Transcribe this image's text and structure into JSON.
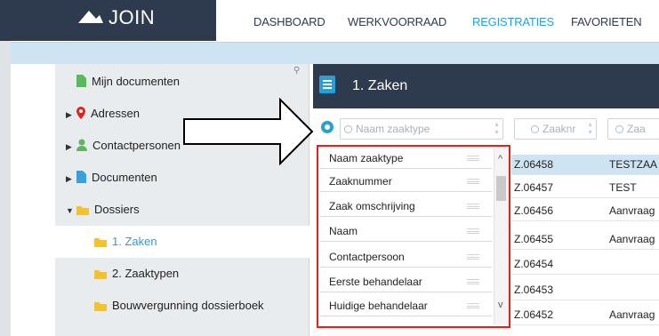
{
  "brand": {
    "name": "JOIN",
    "logo_icon": "join-logo-icon"
  },
  "nav": {
    "items": [
      "DASHBOARD",
      "WERKVOORRAAD",
      "REGISTRATIES",
      "FAVORIETEN"
    ],
    "active": "REGISTRATIES"
  },
  "colors": {
    "navy": "#2e3b4e",
    "accent": "#2a9fd6",
    "band": "#cfe4f2",
    "highlight": "#e0231d",
    "folder": "#f2c230",
    "green_doc": "#5cb85c",
    "blue_doc": "#3aa0d8",
    "red_pin": "#e0231d"
  },
  "sidebar": {
    "items": [
      {
        "label": "Mijn documenten",
        "icon": "document-icon"
      },
      {
        "label": "Adressen",
        "icon": "location-pin-icon"
      },
      {
        "label": "Contactpersonen",
        "icon": "person-icon"
      },
      {
        "label": "Documenten",
        "icon": "document-icon"
      },
      {
        "label": "Dossiers",
        "icon": "folder-icon"
      },
      {
        "label": "1. Zaken",
        "icon": "folder-icon"
      },
      {
        "label": "2. Zaaktypen",
        "icon": "folder-icon"
      },
      {
        "label": "Bouwvergunning dossierboek",
        "icon": "folder-icon"
      }
    ],
    "selected": "1. Zaken",
    "pin_icon": "pin-icon"
  },
  "panel": {
    "title": "1. Zaken",
    "list_icon": "list-icon"
  },
  "filters": {
    "gear_icon": "gear-icon",
    "fields": [
      "Naam zaaktype",
      "Zaaknr",
      "Zaa"
    ]
  },
  "dropdown": {
    "items": [
      "Naam zaaktype",
      "Zaaknummer",
      "Zaak omschrijving",
      "Naam",
      "Contactpersoon",
      "Eerste behandelaar",
      "Huidige behandelaar"
    ],
    "scroll_up": "^",
    "scroll_down": "v"
  },
  "table": {
    "rows": [
      {
        "zaaknummer": "Z.06458",
        "omschrijving": "TESTZAA"
      },
      {
        "zaaknummer": "Z.06457",
        "omschrijving": "TEST"
      },
      {
        "zaaknummer": "Z.06456",
        "omschrijving": "Aanvraag"
      },
      {
        "zaaknummer": "Z.06455",
        "omschrijving": "Aanvraag"
      },
      {
        "zaaknummer": "Z.06454",
        "omschrijving": ""
      },
      {
        "zaaknummer": "Z.06453",
        "omschrijving": ""
      },
      {
        "zaaknummer": "Z.06452",
        "omschrijving": "Aanvraag"
      }
    ],
    "selected_row": 0
  }
}
